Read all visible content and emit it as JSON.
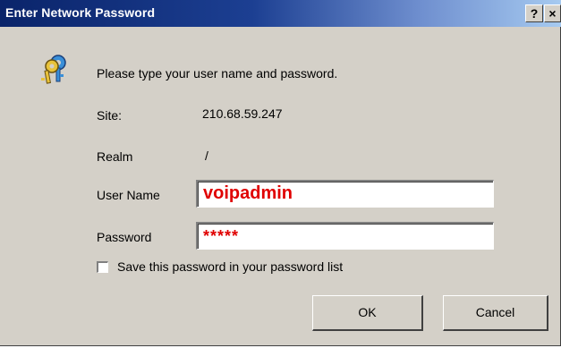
{
  "window": {
    "title": "Enter Network Password",
    "help_label": "?",
    "close_label": "×"
  },
  "prompt": "Please type your user name and password.",
  "site": {
    "label": "Site:",
    "value": "210.68.59.247"
  },
  "realm": {
    "label": "Realm",
    "value": "/"
  },
  "username": {
    "label": "User Name",
    "value": "voipadmin"
  },
  "password": {
    "label": "Password",
    "value": "*****"
  },
  "save_password": {
    "label": "Save this password in your password list",
    "checked": false
  },
  "buttons": {
    "ok": "OK",
    "cancel": "Cancel"
  },
  "colors": {
    "titlebar": "#0a246a",
    "field_text": "#e00000",
    "dialog_bg": "#d4d0c8"
  },
  "icons": {
    "prompt_icon": "keys-icon"
  }
}
